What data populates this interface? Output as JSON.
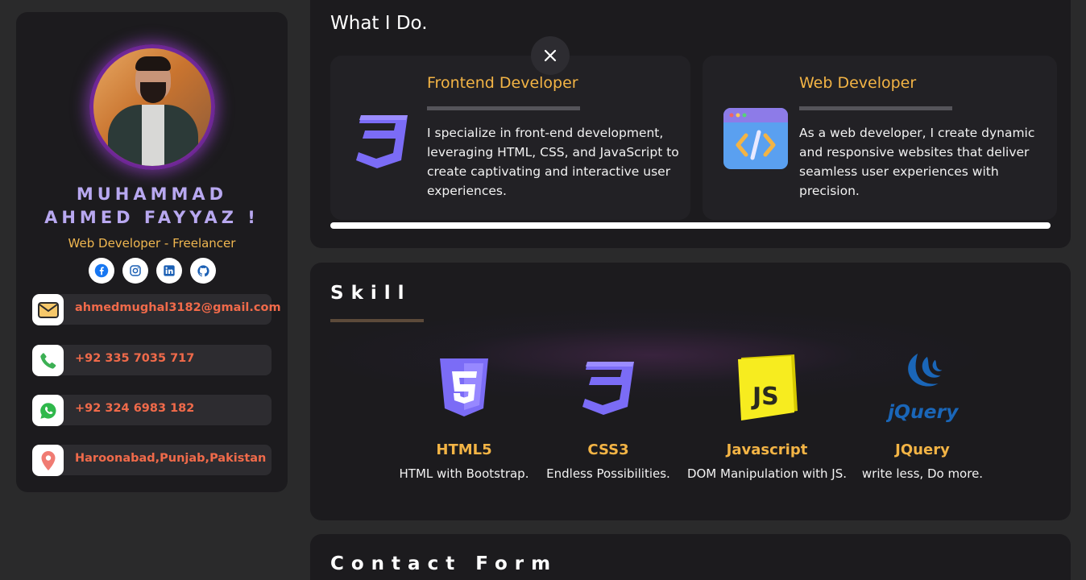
{
  "profile": {
    "name_line1": "MUHAMMAD",
    "name_line2": "AHMED FAYYAZ !",
    "role": "Web Developer - Freelancer",
    "socials": [
      "facebook-icon",
      "instagram-icon",
      "linkedin-icon",
      "github-icon"
    ],
    "contacts": [
      {
        "icon": "email-icon",
        "value": "ahmedmughal3182@gmail.com"
      },
      {
        "icon": "phone-icon",
        "value": "+92 335 7035 717"
      },
      {
        "icon": "whatsapp-icon",
        "value": "+92 324 6983 182"
      },
      {
        "icon": "location-icon",
        "value": "Haroonabad,Punjab,Pakistan"
      }
    ]
  },
  "what_i_do": {
    "title": "What I Do.",
    "services": [
      {
        "icon": "css3-icon",
        "title": "Frontend Developer",
        "description": "I specialize in front-end development, leveraging HTML, CSS, and JavaScript to create captivating and interactive user experiences."
      },
      {
        "icon": "code-window-icon",
        "title": "Web Developer",
        "description": "As a web developer, I create dynamic and responsive websites that deliver seamless user experiences with precision."
      }
    ]
  },
  "skill": {
    "title": "Skill",
    "items": [
      {
        "icon": "html5-icon",
        "name": "HTML5",
        "description": "HTML with Bootstrap."
      },
      {
        "icon": "css3-icon",
        "name": "CSS3",
        "description": "Endless Possibilities."
      },
      {
        "icon": "javascript-icon",
        "name": "Javascript",
        "description": "DOM Manipulation with JS."
      },
      {
        "icon": "jquery-icon",
        "name": "JQuery",
        "description": "write less, Do more."
      }
    ]
  },
  "contact_form": {
    "title": "Contact Form"
  },
  "colors": {
    "background": "#2a2a2b",
    "card": "#1c1b1e",
    "accent_gold": "#f3b445",
    "accent_orange": "#f06a4a",
    "name_lavender": "#b8a8f0"
  }
}
